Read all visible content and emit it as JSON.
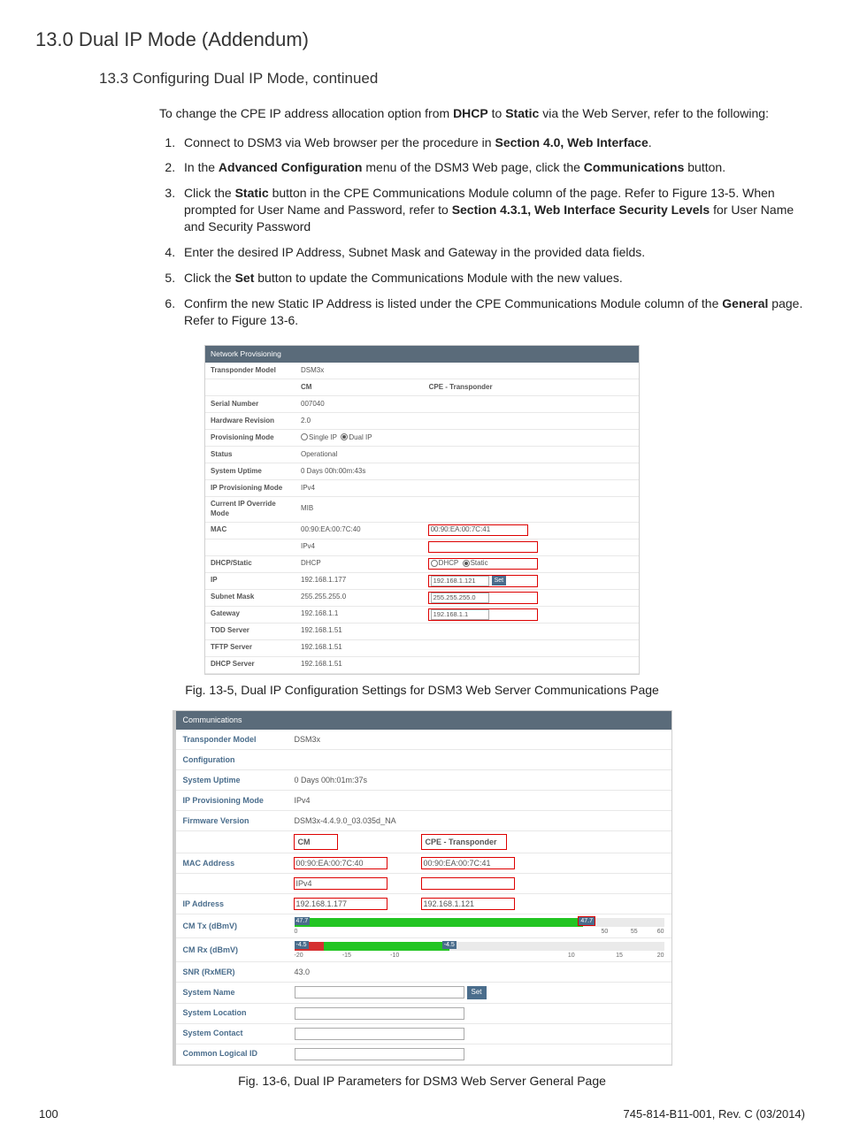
{
  "title": "13.0  Dual IP Mode (Addendum)",
  "subtitle": "13.3   Configuring Dual IP Mode, continued",
  "intro_pre": "To change the CPE IP address allocation option from ",
  "intro_b1": "DHCP",
  "intro_mid": " to ",
  "intro_b2": "Static",
  "intro_post": " via the Web Server, refer to the following:",
  "steps": {
    "s1a": "Connect to DSM3 via Web browser per the procedure in ",
    "s1b": "Section 4.0, Web Interface",
    "s1c": ".",
    "s2a": "In the ",
    "s2b": "Advanced Configuration",
    "s2c": " menu of the DSM3 Web page, click the ",
    "s2d": "Communications",
    "s2e": " button.",
    "s3a": "Click the ",
    "s3b": "Static",
    "s3c": " button in the CPE Communications Module column of the page. Refer to Figure 13-5. When prompted for User Name and Password, refer to ",
    "s3d": "Section 4.3.1, Web Interface Security Levels",
    "s3e": " for User Name and Security Password",
    "s4": "Enter the desired IP Address, Subnet Mask and Gateway in the provided data fields.",
    "s5a": "Click the ",
    "s5b": "Set",
    "s5c": " button to update the Communications Module with the new values.",
    "s6a": "Confirm the new Static IP Address is listed under the CPE Communications Module column of the ",
    "s6b": "General",
    "s6c": " page. Refer to Figure 13-6."
  },
  "fig1": {
    "header": "Network Provisioning",
    "rows": {
      "transponder_model_lbl": "Transponder Model",
      "transponder_model": "DSM3x",
      "cm_hdr": "CM",
      "cpe_hdr": "CPE - Transponder",
      "serial_lbl": "Serial Number",
      "serial": "007040",
      "hw_lbl": "Hardware Revision",
      "hw": "2.0",
      "prov_lbl": "Provisioning Mode",
      "prov_single": "Single IP",
      "prov_dual": "Dual IP",
      "status_lbl": "Status",
      "status": "Operational",
      "uptime_lbl": "System Uptime",
      "uptime": "0 Days 00h:00m:43s",
      "ipmode_lbl": "IP Provisioning Mode",
      "ipmode": "IPv4",
      "override_lbl": "Current IP Override Mode",
      "override": "MIB",
      "mac_lbl": "MAC",
      "mac_cm": "00:90:EA:00:7C:40",
      "mac_cpe": "00:90:EA:00:7C:41",
      "ipv4_row": "IPv4",
      "dhcp_lbl": "DHCP/Static",
      "dhcp_cm": "DHCP",
      "dhcp_opt": "DHCP",
      "static_opt": "Static",
      "ip_lbl": "IP",
      "ip_cm": "192.168.1.177",
      "ip_cpe": "192.168.1.121",
      "set_btn": "Set",
      "subnet_lbl": "Subnet Mask",
      "subnet_cm": "255.255.255.0",
      "subnet_cpe": "255.255.255.0",
      "gw_lbl": "Gateway",
      "gw_cm": "192.168.1.1",
      "gw_cpe": "192.168.1.1",
      "tod_lbl": "TOD Server",
      "tod": "192.168.1.51",
      "tftp_lbl": "TFTP Server",
      "tftp": "192.168.1.51",
      "dhcps_lbl": "DHCP Server",
      "dhcps": "192.168.1.51"
    },
    "caption": "Fig. 13-5, Dual IP Configuration Settings for DSM3 Web Server Communications Page"
  },
  "fig2": {
    "header": "Communications",
    "rows": {
      "tm_lbl": "Transponder Model",
      "tm": "DSM3x",
      "cfg_lbl": "Configuration",
      "uptime_lbl": "System Uptime",
      "uptime": "0 Days 00h:01m:37s",
      "ipmode_lbl": "IP Provisioning Mode",
      "ipmode": "IPv4",
      "fw_lbl": "Firmware Version",
      "fw": "DSM3x-4.4.9.0_03.035d_NA",
      "cm_hdr": "CM",
      "cpe_hdr": "CPE - Transponder",
      "mac_lbl": "MAC Address",
      "mac_cm": "00:90:EA:00:7C:40",
      "mac_cpe": "00:90:EA:00:7C:41",
      "ipv4_row": "IPv4",
      "ipa_lbl": "IP Address",
      "ipa_cm": "192.168.1.177",
      "ipa_cpe": "192.168.1.121",
      "tx_lbl": "CM Tx (dBmV)",
      "tx_val": "47.7",
      "tx_0": "0",
      "tx_50": "50",
      "tx_55": "55",
      "tx_60": "60",
      "rx_lbl": "CM Rx (dBmV)",
      "rx_val": "-4.5",
      "rx_n20": "-20",
      "rx_n15": "-15",
      "rx_n10": "-10",
      "rx_10": "10",
      "rx_15": "15",
      "rx_20": "20",
      "snr_lbl": "SNR (RxMER)",
      "snr": "43.0",
      "sname_lbl": "System Name",
      "set_btn": "Set",
      "sloc_lbl": "System Location",
      "scon_lbl": "System Contact",
      "cli_lbl": "Common Logical ID"
    },
    "caption": "Fig. 13-6, Dual IP Parameters for DSM3 Web Server General Page"
  },
  "footer": {
    "page": "100",
    "doc": "745-814-B11-001, Rev. C (03/2014)"
  }
}
